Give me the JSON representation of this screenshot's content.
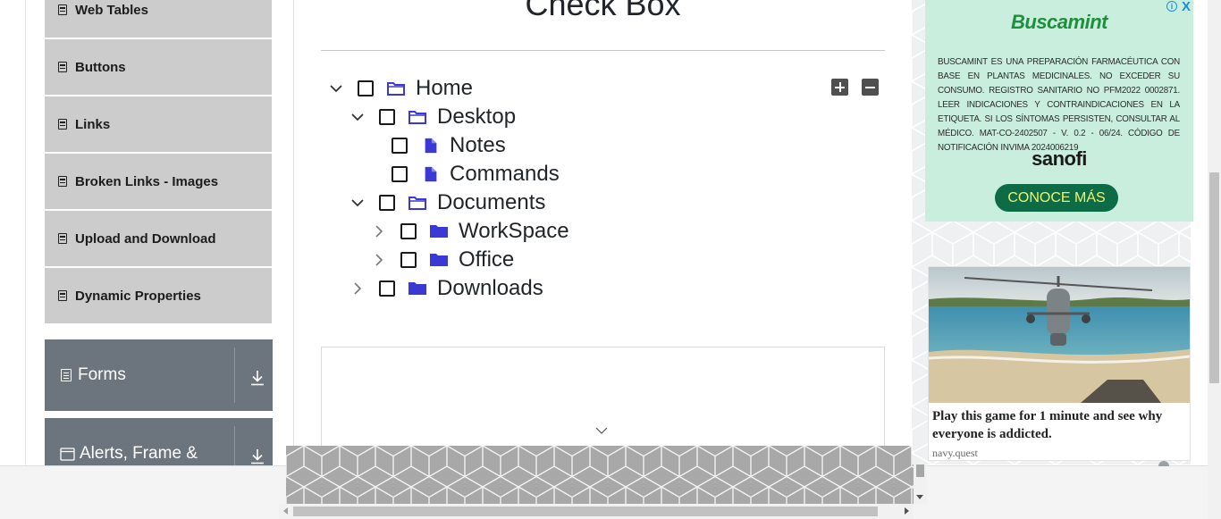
{
  "sidebar": {
    "elements_items": [
      {
        "label": "Web Tables"
      },
      {
        "label": "Buttons"
      },
      {
        "label": "Links"
      },
      {
        "label": "Broken Links - Images"
      },
      {
        "label": "Upload and Download"
      },
      {
        "label": "Dynamic Properties"
      }
    ],
    "groups": [
      {
        "label": "Forms"
      },
      {
        "label": "Alerts, Frame &"
      }
    ]
  },
  "main": {
    "title": "Check Box",
    "tree": [
      {
        "label": "Home",
        "expanded": true,
        "level": 0,
        "type": "folder-open",
        "checked": false
      },
      {
        "label": "Desktop",
        "expanded": true,
        "level": 1,
        "type": "folder-open",
        "checked": false
      },
      {
        "label": "Notes",
        "level": 2,
        "type": "file",
        "checked": false
      },
      {
        "label": "Commands",
        "level": 2,
        "type": "file",
        "checked": false
      },
      {
        "label": "Documents",
        "expanded": true,
        "level": 1,
        "type": "folder-open",
        "checked": false
      },
      {
        "label": "WorkSpace",
        "expanded": false,
        "level": 2,
        "type": "folder-closed",
        "checked": false
      },
      {
        "label": "Office",
        "expanded": false,
        "level": 2,
        "type": "folder-closed",
        "checked": false
      },
      {
        "label": "Downloads",
        "expanded": false,
        "level": 1,
        "type": "folder-closed",
        "checked": false
      }
    ],
    "expand_all_icon": "plus-square-icon",
    "collapse_all_icon": "minus-square-icon"
  },
  "ads": {
    "ad1": {
      "brand": "Buscamint",
      "disclaimer": "BUSCAMINT ES UNA PREPARACIÓN FARMACÉUTICA CON BASE EN PLANTAS MEDICINALES. NO EXCEDER SU CONSUMO. REGISTRO SANITARIO NO PFM2022 0002871. LEER INDICACIONES Y CONTRAINDICACIONES EN LA ETIQUETA. SI LOS SÍNTOMAS PERSISTEN, CONSULTAR AL MÉDICO. MAT-CO-2402507 - V. 0.2 - 06/24. CÓDIGO DE NOTIFICACIÓN INVIMA 2024006219",
      "company": "sanofi",
      "cta": "CONOCE MÁS",
      "info_icon": "i",
      "close_icon": "X"
    },
    "ad2": {
      "text": "Play this game for 1 minute and see why everyone is addicted.",
      "source": "navy.quest"
    }
  },
  "colors": {
    "folder": "#3b39d3",
    "sidebar_item_bg": "#cccccc",
    "group_header_bg": "#6c757d",
    "ad_green": "#0d6b46"
  }
}
